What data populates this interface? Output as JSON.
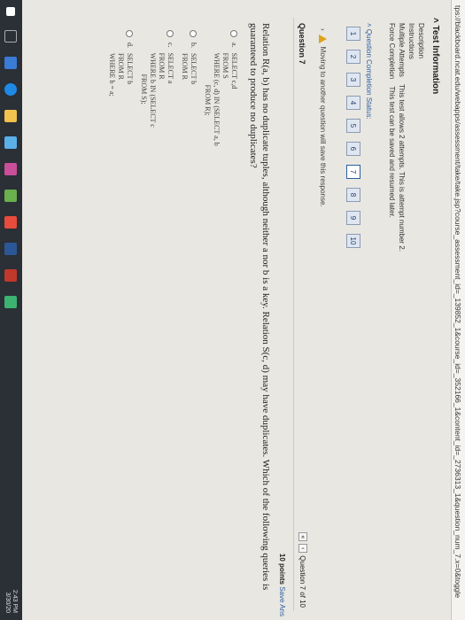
{
  "browser": {
    "url": "tps://blackboard.ncat.edu/webapps/assessment/take/take.jsp?course_assessment_id=_139852_1&course_id=_352166_1&content_id=_2736313_1&question_num_7.x=0&toggle"
  },
  "test_info": {
    "title": "Test Information",
    "rows": [
      {
        "key": "Description",
        "value": ""
      },
      {
        "key": "Instructions",
        "value": ""
      },
      {
        "key": "Multiple Attempts",
        "value": "This test allows 2 attempts. This is attempt number 2."
      },
      {
        "key": "Force Completion",
        "value": "This test can be saved and resumed later."
      }
    ]
  },
  "completion": {
    "label": "Question Completion Status:",
    "questions": [
      "1",
      "2",
      "3",
      "4",
      "5",
      "6",
      "7",
      "8",
      "9",
      "10"
    ],
    "current": "7"
  },
  "warning": "Moving to another question will save this response.",
  "question": {
    "title": "Question 7",
    "nav_text": "Question 7 of 10",
    "points": "10 points",
    "save_label": "Save Ans",
    "text": "Relation R(a, b) has no duplicate tuples, although neither a nor b is a key. Relation S(c, d) may have duplicates. Which of the following queries is guaranteed to produce no duplicates?",
    "options": [
      {
        "letter": "a.",
        "code": "SELECT c,d\nFROM S\nWHERE (c, d) IN (SELECT a, b\n                  FROM R);"
      },
      {
        "letter": "b.",
        "code": "SELECT b\nFROM R"
      },
      {
        "letter": "c.",
        "code": "SELECT a\nFROM R\nWHERE b IN (SELECT c\n            FROM S);"
      },
      {
        "letter": "d.",
        "code": "SELECT b\nFROM R\nWHERE b = a;"
      }
    ]
  },
  "taskbar": {
    "time": "2:43 PM",
    "date": "3/30/20"
  },
  "colors": {
    "accent": "#2a5fa0",
    "warning": "#e0a21a",
    "taskbar": "#2b2f36"
  }
}
